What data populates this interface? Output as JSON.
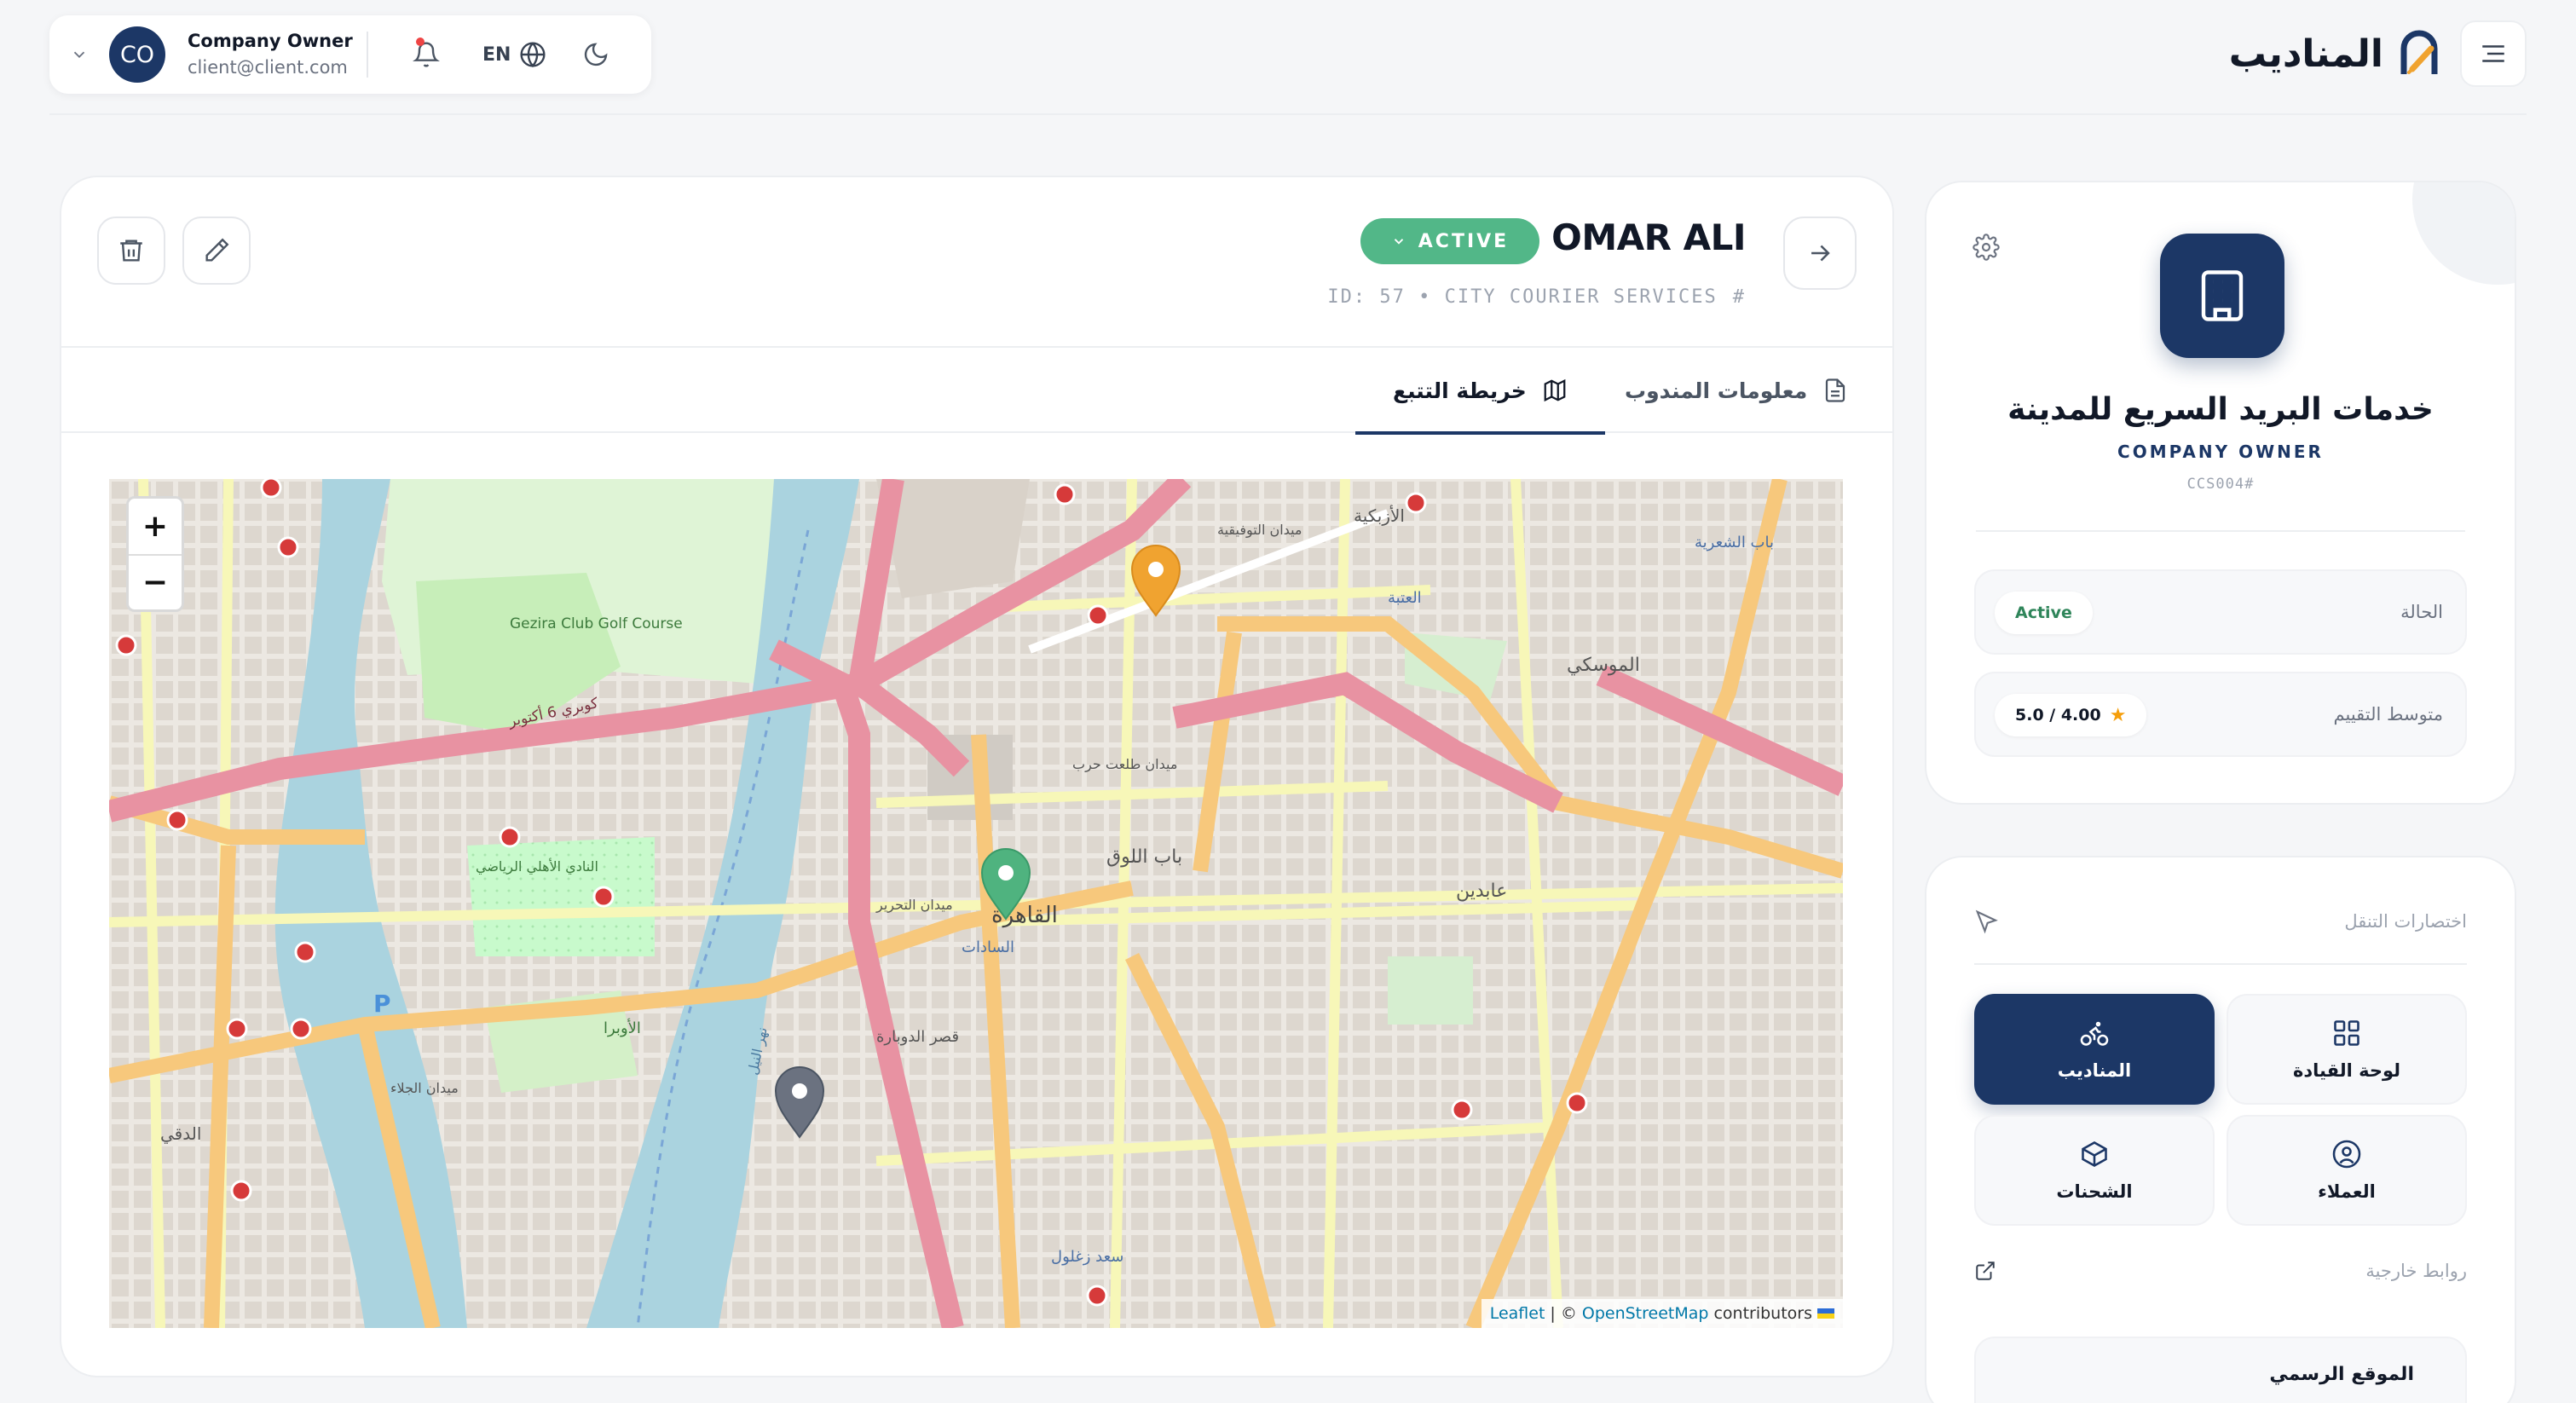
{
  "header": {
    "account": {
      "initials": "CO",
      "name": "Company Owner",
      "email": "client@client.com"
    },
    "language": "EN",
    "brand_name": "المناديب"
  },
  "rider": {
    "name": "OMAR ALI",
    "status": "ACTIVE",
    "id_line": "ID: 57 • CITY COURIER SERVICES",
    "hash": "#"
  },
  "tabs": [
    {
      "label": "خريطة التتبع",
      "active": true
    },
    {
      "label": "معلومات المندوب",
      "active": false
    }
  ],
  "map": {
    "zoom_in": "+",
    "zoom_out": "−",
    "attribution": {
      "leaflet": "Leaflet",
      "separator": "| ©",
      "osm": "OpenStreetMap",
      "contributors": "contributors"
    },
    "labels": {
      "cairo": "القاهرة",
      "sadat": "السادات",
      "golf": "Gezira Club Golf Course",
      "bridge": "كوبري 6 أكتوبر",
      "tahrir": "ميدان التحرير",
      "bab_luq": "باب اللوق",
      "zamalek_club": "النادي الأهلي الرياضي",
      "opera": "الأوبرا",
      "saad_zaghloul": "سعد زغلول",
      "qasr_dobara": "قصر الدوبارة",
      "abdeen": "عابدين",
      "ataba": "العتبة",
      "muski": "الموسكي",
      "bab_shaaria": "باب الشعرية",
      "dokki": "الدقي",
      "nile": "نهر النيل",
      "midan_galaa": "ميدان الجلاء",
      "tawfikia": "ميدان التوفيقية",
      "azbakeya": "الأزبكية",
      "talaat": "ميدان طلعت حرب"
    },
    "colors": {
      "water": "#aad3df",
      "park": "#c8facc",
      "primary_road": "#e892a2",
      "secondary_road": "#f7c87c",
      "tertiary_road": "#f7f7b8",
      "marker_orange": "#f0a330",
      "marker_green": "#4fb37f",
      "marker_gray": "#6b7280"
    }
  },
  "company": {
    "name": "خدمات البريد السريع للمدينة",
    "role": "COMPANY OWNER",
    "code": "CCS004#",
    "status_label": "الحالة",
    "status_value": "Active",
    "rating_label": "متوسط التقييم",
    "rating_value": "5.0 / 4.00"
  },
  "navigation": {
    "title": "اختصارات التنقل",
    "tiles": [
      {
        "label": "المناديب",
        "icon": "bike-icon",
        "active": true
      },
      {
        "label": "لوحة القيادة",
        "icon": "dashboard-icon",
        "active": false
      },
      {
        "label": "الشحنات",
        "icon": "package-icon",
        "active": false
      },
      {
        "label": "العملاء",
        "icon": "user-circle-icon",
        "active": false
      }
    ],
    "external_title": "روابط خارجية",
    "external_item": "الموقع الرسمي"
  },
  "theme": {
    "primary": "#1c3766",
    "active_green": "#52b788"
  }
}
